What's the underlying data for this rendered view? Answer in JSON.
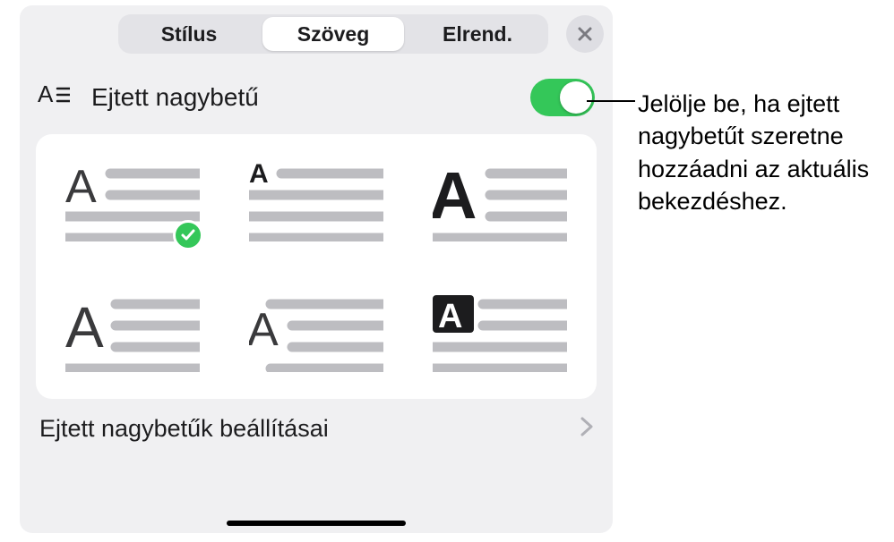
{
  "tabs": {
    "style": "Stílus",
    "text": "Szöveg",
    "layout": "Elrend."
  },
  "dropcap": {
    "title": "Ejtett nagybetű",
    "toggle_on": true,
    "settings_label": "Ejtett nagybetűk beállításai"
  },
  "styles": [
    {
      "name": "dropcap-raised-2line",
      "selected": true
    },
    {
      "name": "dropcap-small-top",
      "selected": false
    },
    {
      "name": "dropcap-large-bold",
      "selected": false
    },
    {
      "name": "dropcap-3line-left",
      "selected": false
    },
    {
      "name": "dropcap-margin-left",
      "selected": false
    },
    {
      "name": "dropcap-boxed-inverse",
      "selected": false
    }
  ],
  "icons": {
    "close": "close-icon",
    "dropcap_row": "dropcap-icon",
    "chevron": "chevron-right-icon",
    "check": "check-icon"
  },
  "callout": {
    "text": "Jelölje be, ha ejtett nagybetűt szeretne hozzáadni az aktuális bekezdéshez."
  },
  "colors": {
    "accent": "#34c759",
    "line": "#bdbdc1"
  }
}
